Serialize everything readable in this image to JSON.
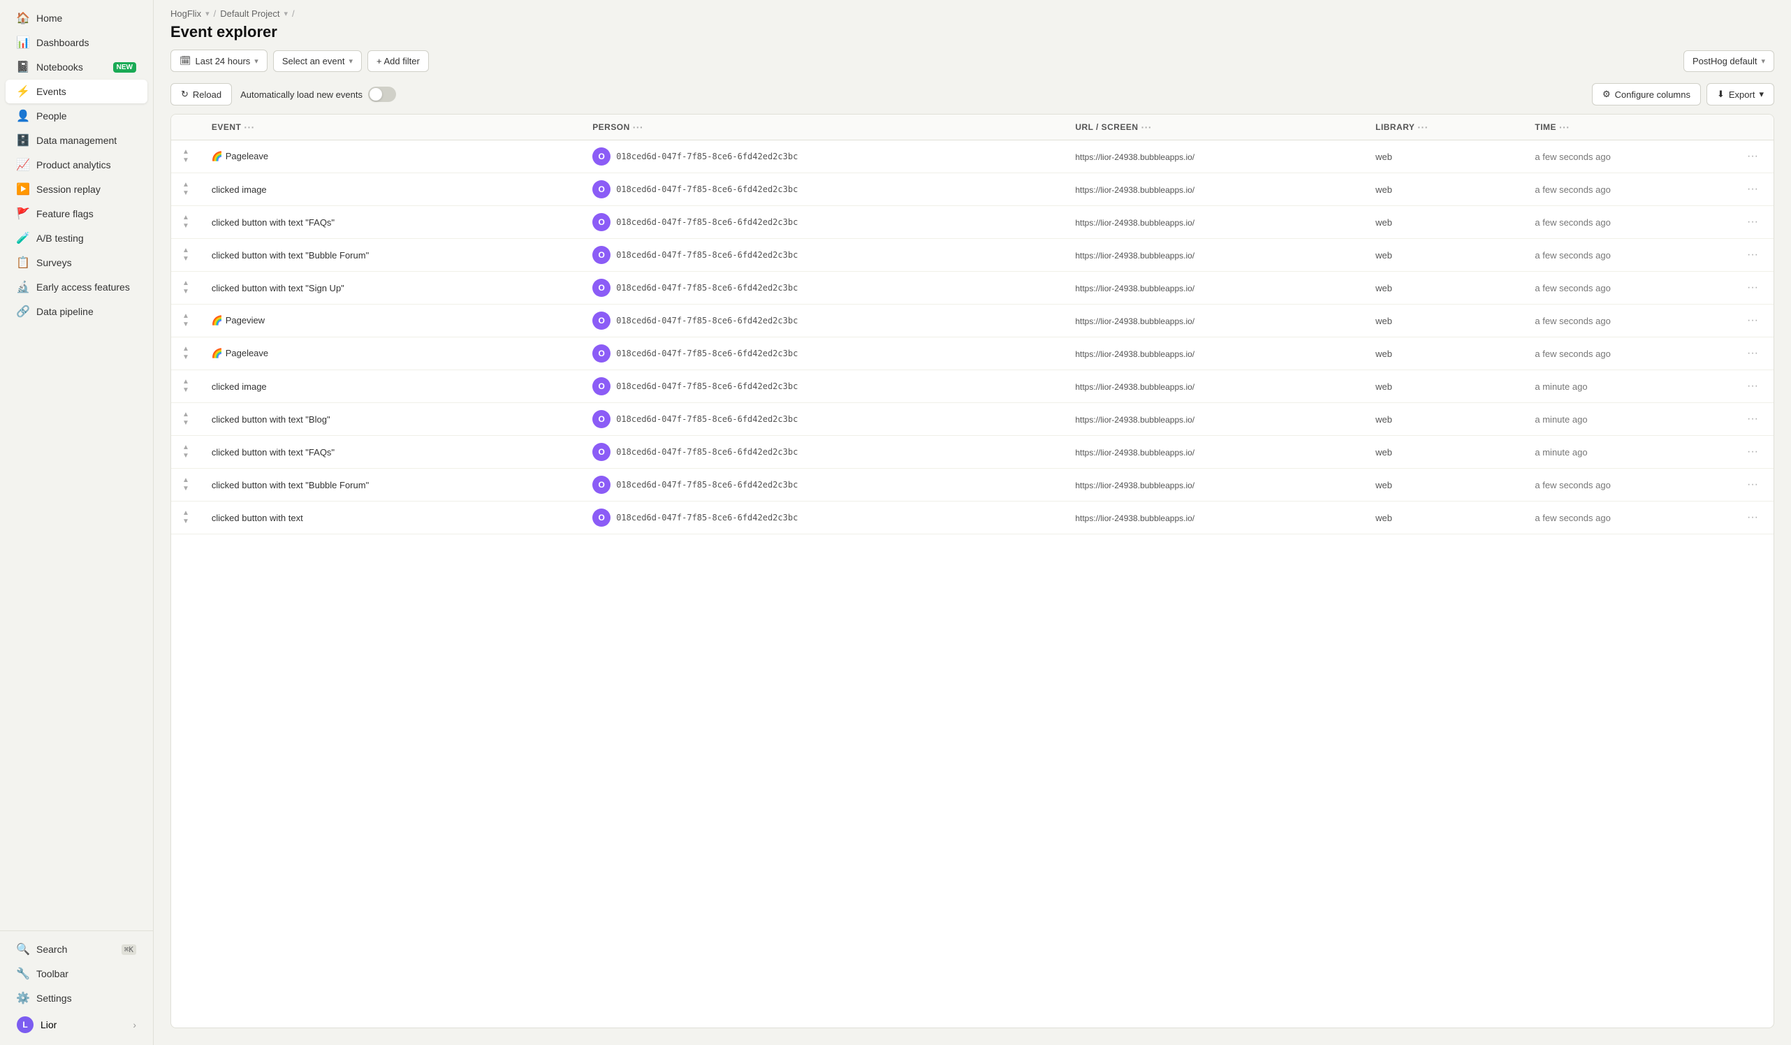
{
  "sidebar": {
    "items": [
      {
        "id": "home",
        "label": "Home",
        "icon": "🏠",
        "badge": null
      },
      {
        "id": "dashboards",
        "label": "Dashboards",
        "icon": "📊",
        "badge": null
      },
      {
        "id": "notebooks",
        "label": "Notebooks",
        "icon": "📓",
        "badge": "NEW"
      },
      {
        "id": "events",
        "label": "Events",
        "icon": "⚡",
        "badge": null,
        "active": true
      },
      {
        "id": "people",
        "label": "People",
        "icon": "👤",
        "badge": null
      },
      {
        "id": "data-management",
        "label": "Data management",
        "icon": "🗄️",
        "badge": null
      },
      {
        "id": "product-analytics",
        "label": "Product analytics",
        "icon": "📈",
        "badge": null
      },
      {
        "id": "session-replay",
        "label": "Session replay",
        "icon": "▶️",
        "badge": null
      },
      {
        "id": "feature-flags",
        "label": "Feature flags",
        "icon": "🚩",
        "badge": null
      },
      {
        "id": "ab-testing",
        "label": "A/B testing",
        "icon": "🧪",
        "badge": null
      },
      {
        "id": "surveys",
        "label": "Surveys",
        "icon": "📋",
        "badge": null
      },
      {
        "id": "early-access",
        "label": "Early access features",
        "icon": "🔬",
        "badge": null
      },
      {
        "id": "data-pipeline",
        "label": "Data pipeline",
        "icon": "🔗",
        "badge": null
      }
    ],
    "bottom": [
      {
        "id": "search",
        "label": "Search",
        "icon": "🔍",
        "kbd": "⌘K"
      },
      {
        "id": "toolbar",
        "label": "Toolbar",
        "icon": "🔧"
      },
      {
        "id": "settings",
        "label": "Settings",
        "icon": "⚙️"
      }
    ],
    "user": {
      "name": "Lior",
      "initial": "L"
    }
  },
  "breadcrumb": {
    "items": [
      "HogFlix",
      "Default Project"
    ],
    "arrows": [
      "▾",
      "▾"
    ]
  },
  "header": {
    "title": "Event explorer"
  },
  "toolbar": {
    "time_range": "Last 24 hours",
    "event_select": "Select an event",
    "add_filter": "+ Add filter",
    "posthog_default": "PostHog default",
    "reload": "Reload",
    "auto_load": "Automatically load new events",
    "configure_columns": "Configure columns",
    "export": "Export"
  },
  "table": {
    "columns": [
      "EVENT",
      "PERSON",
      "URL / SCREEN",
      "LIBRARY",
      "TIME"
    ],
    "rows": [
      {
        "event": "🌈 Pageleave",
        "person_id": "018ced6d-047f-7f85-8ce6-6fd42ed2c3bc",
        "url": "https://lior-24938.bubbleapps.io/",
        "library": "web",
        "time": "a few seconds ago"
      },
      {
        "event": "clicked image",
        "person_id": "018ced6d-047f-7f85-8ce6-6fd42ed2c3bc",
        "url": "https://lior-24938.bubbleapps.io/",
        "library": "web",
        "time": "a few seconds ago"
      },
      {
        "event": "clicked button with text \"FAQs\"",
        "person_id": "018ced6d-047f-7f85-8ce6-6fd42ed2c3bc",
        "url": "https://lior-24938.bubbleapps.io/",
        "library": "web",
        "time": "a few seconds ago"
      },
      {
        "event": "clicked button with text \"Bubble Forum\"",
        "person_id": "018ced6d-047f-7f85-8ce6-6fd42ed2c3bc",
        "url": "https://lior-24938.bubbleapps.io/",
        "library": "web",
        "time": "a few seconds ago"
      },
      {
        "event": "clicked button with text \"Sign Up\"",
        "person_id": "018ced6d-047f-7f85-8ce6-6fd42ed2c3bc",
        "url": "https://lior-24938.bubbleapps.io/",
        "library": "web",
        "time": "a few seconds ago"
      },
      {
        "event": "🌈 Pageview",
        "person_id": "018ced6d-047f-7f85-8ce6-6fd42ed2c3bc",
        "url": "https://lior-24938.bubbleapps.io/",
        "library": "web",
        "time": "a few seconds ago"
      },
      {
        "event": "🌈 Pageleave",
        "person_id": "018ced6d-047f-7f85-8ce6-6fd42ed2c3bc",
        "url": "https://lior-24938.bubbleapps.io/",
        "library": "web",
        "time": "a few seconds ago"
      },
      {
        "event": "clicked image",
        "person_id": "018ced6d-047f-7f85-8ce6-6fd42ed2c3bc",
        "url": "https://lior-24938.bubbleapps.io/",
        "library": "web",
        "time": "a minute ago"
      },
      {
        "event": "clicked button with text \"Blog\"",
        "person_id": "018ced6d-047f-7f85-8ce6-6fd42ed2c3bc",
        "url": "https://lior-24938.bubbleapps.io/",
        "library": "web",
        "time": "a minute ago"
      },
      {
        "event": "clicked button with text \"FAQs\"",
        "person_id": "018ced6d-047f-7f85-8ce6-6fd42ed2c3bc",
        "url": "https://lior-24938.bubbleapps.io/",
        "library": "web",
        "time": "a minute ago"
      },
      {
        "event": "clicked button with text \"Bubble Forum\"",
        "person_id": "018ced6d-047f-7f85-8ce6-6fd42ed2c3bc",
        "url": "https://lior-24938.bubbleapps.io/",
        "library": "web",
        "time": "a few seconds ago"
      },
      {
        "event": "clicked button with text",
        "person_id": "018ced6d-047f-7f85-8ce6-6fd42ed2c3bc",
        "url": "https://lior-24938.bubbleapps.io/",
        "library": "web",
        "time": "a few seconds ago"
      }
    ]
  }
}
